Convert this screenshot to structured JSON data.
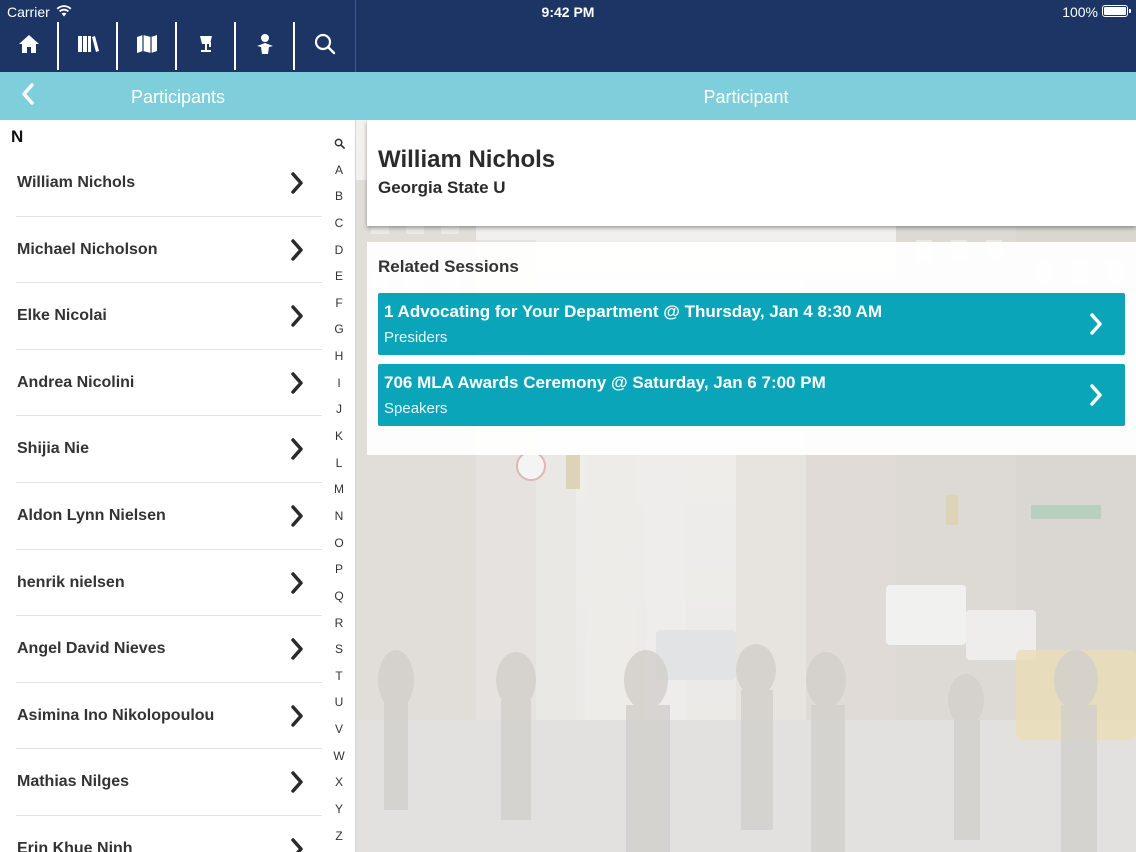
{
  "status_bar": {
    "carrier": "Carrier",
    "time": "9:42 PM",
    "battery": "100%"
  },
  "toolbar": {
    "items": [
      {
        "icon": "home-icon"
      },
      {
        "icon": "books-icon"
      },
      {
        "icon": "map-icon"
      },
      {
        "icon": "lamp-icon"
      },
      {
        "icon": "person-icon"
      },
      {
        "icon": "search-icon"
      }
    ]
  },
  "nav": {
    "left_title": "Participants",
    "right_title": "Participant"
  },
  "list": {
    "section": "N",
    "items": [
      {
        "name": "William Nichols"
      },
      {
        "name": "Michael Nicholson"
      },
      {
        "name": "Elke Nicolai"
      },
      {
        "name": "Andrea Nicolini"
      },
      {
        "name": "Shijia Nie"
      },
      {
        "name": "Aldon Lynn Nielsen"
      },
      {
        "name": "henrik nielsen"
      },
      {
        "name": "Angel David Nieves"
      },
      {
        "name": "Asimina Ino Nikolopoulou"
      },
      {
        "name": "Mathias Nilges"
      },
      {
        "name": "Erin Khue Ninh"
      }
    ]
  },
  "index": [
    "A",
    "B",
    "C",
    "D",
    "E",
    "F",
    "G",
    "H",
    "I",
    "J",
    "K",
    "L",
    "M",
    "N",
    "O",
    "P",
    "Q",
    "R",
    "S",
    "T",
    "U",
    "V",
    "W",
    "X",
    "Y",
    "Z"
  ],
  "detail": {
    "name": "William Nichols",
    "affiliation": "Georgia State U",
    "related_title": "Related Sessions",
    "sessions": [
      {
        "title": "1 Advocating for Your Department @ Thursday, Jan 4 8:30 AM",
        "role": "Presiders"
      },
      {
        "title": "706 MLA Awards Ceremony @ Saturday, Jan 6 7:00 PM",
        "role": "Speakers"
      }
    ]
  },
  "colors": {
    "header": "#1c3564",
    "navbar": "#7ecfdb",
    "session_button": "#0aa5b9"
  }
}
